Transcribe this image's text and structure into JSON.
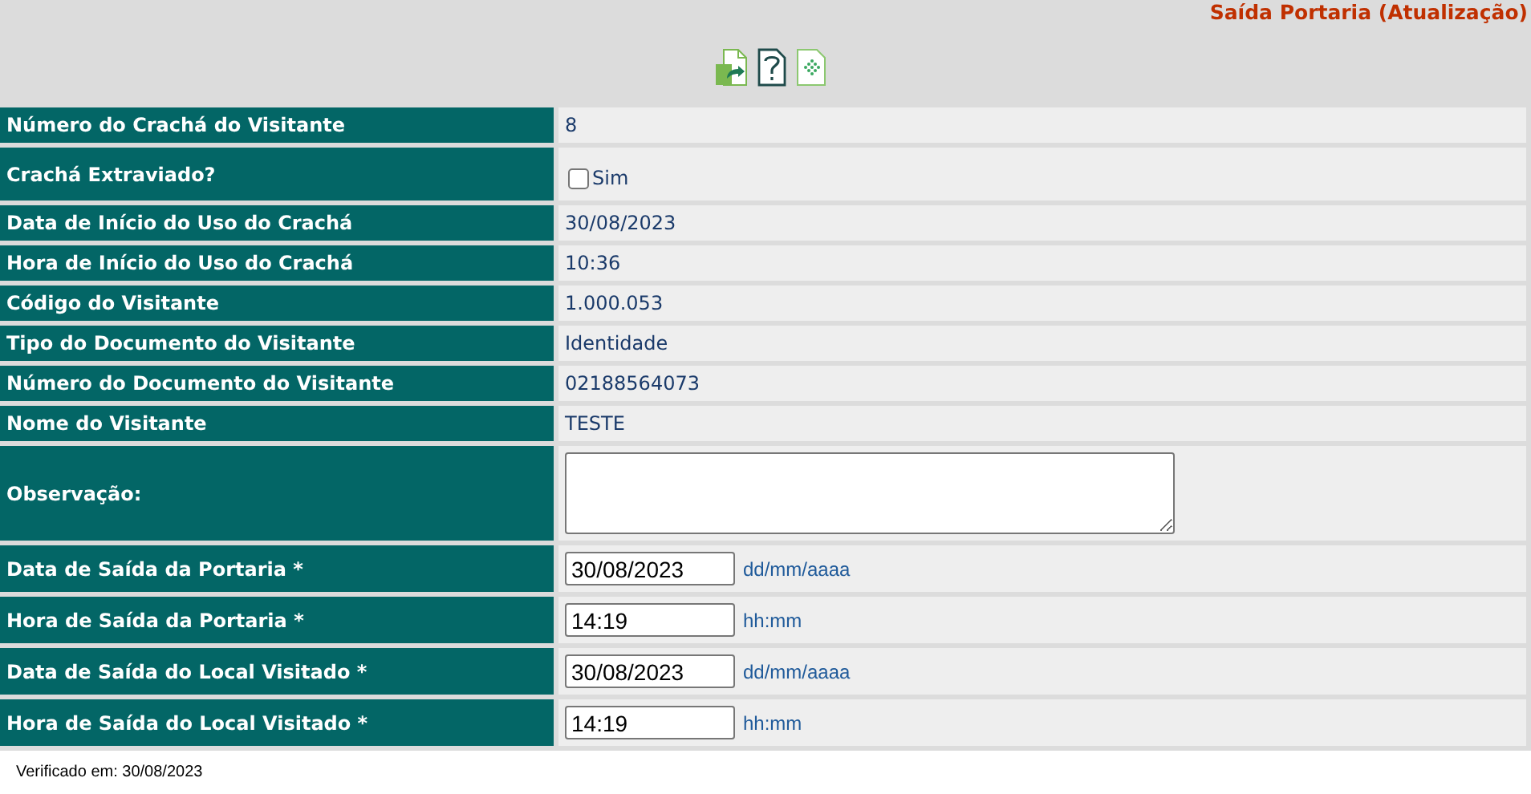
{
  "page_title": "Saída Portaria (Atualização)",
  "fields": [
    {
      "kind": "text",
      "label": "Número do Crachá do Visitante",
      "value": "8"
    },
    {
      "kind": "checkbox",
      "label": "Crachá Extraviado?",
      "option": "Sim",
      "checked": false
    },
    {
      "kind": "text",
      "label": "Data de Início do Uso do Crachá",
      "value": "30/08/2023"
    },
    {
      "kind": "text",
      "label": "Hora de Início do Uso do Crachá",
      "value": "10:36"
    },
    {
      "kind": "text",
      "label": "Código do Visitante",
      "value": "1.000.053"
    },
    {
      "kind": "text",
      "label": "Tipo do Documento do Visitante",
      "value": "Identidade"
    },
    {
      "kind": "text",
      "label": "Número do Documento do Visitante",
      "value": "02188564073"
    },
    {
      "kind": "text",
      "label": "Nome do Visitante",
      "value": "TESTE"
    },
    {
      "kind": "textarea",
      "label": "Observação:"
    },
    {
      "kind": "input",
      "label": "Data de Saída da Portaria *",
      "value": "30/08/2023",
      "hint": "dd/mm/aaaa"
    },
    {
      "kind": "input",
      "label": "Hora de Saída da Portaria *",
      "value": "14:19",
      "hint": "hh:mm"
    },
    {
      "kind": "input",
      "label": "Data de Saída do Local Visitado *",
      "value": "30/08/2023",
      "hint": "dd/mm/aaaa"
    },
    {
      "kind": "input",
      "label": "Hora de Saída do Local Visitado *",
      "value": "14:19",
      "hint": "hh:mm"
    }
  ],
  "footer": "Verificado em: 30/08/2023"
}
